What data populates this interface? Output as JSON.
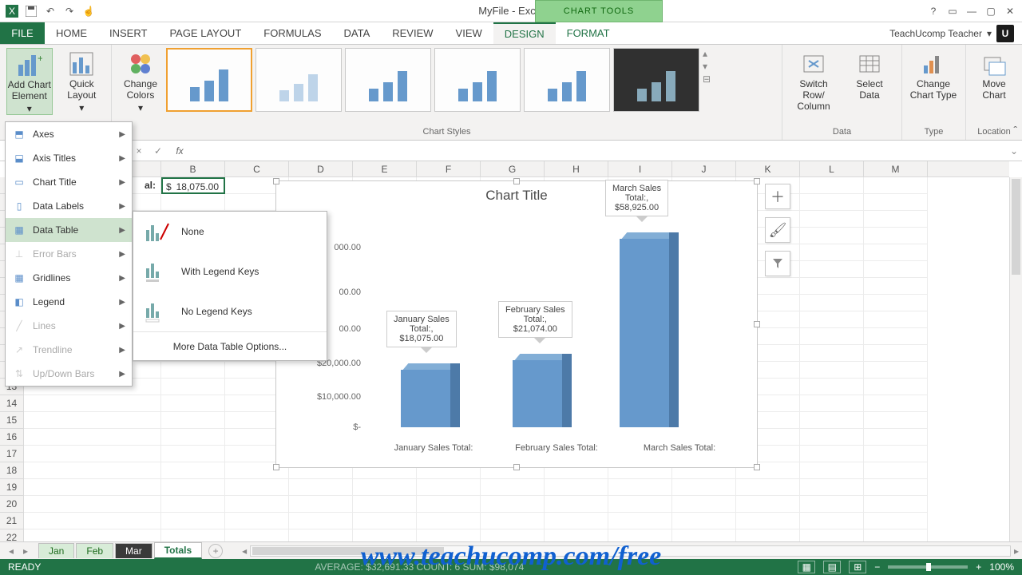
{
  "titlebar": {
    "title": "MyFile - Excel",
    "chart_tools": "CHART TOOLS"
  },
  "tabs": {
    "file": "FILE",
    "home": "HOME",
    "insert": "INSERT",
    "pagelayout": "PAGE LAYOUT",
    "formulas": "FORMULAS",
    "data": "DATA",
    "review": "REVIEW",
    "view": "VIEW",
    "design": "DESIGN",
    "format": "FORMAT",
    "user": "TeachUcomp Teacher"
  },
  "ribbon": {
    "add_chart_element": "Add Chart\nElement",
    "quick_layout": "Quick\nLayout",
    "change_colors": "Change\nColors",
    "switch": "Switch Row/\nColumn",
    "select_data": "Select\nData",
    "change_type": "Change\nChart Type",
    "move_chart": "Move\nChart",
    "group_styles": "Chart Styles",
    "group_data": "Data",
    "group_type": "Type",
    "group_location": "Location"
  },
  "dropdown": {
    "axes": "Axes",
    "axis_titles": "Axis Titles",
    "chart_title": "Chart Title",
    "data_labels": "Data Labels",
    "data_table": "Data Table",
    "error_bars": "Error Bars",
    "gridlines": "Gridlines",
    "legend": "Legend",
    "lines": "Lines",
    "trendline": "Trendline",
    "updown": "Up/Down Bars"
  },
  "submenu": {
    "none": "None",
    "with_legend": "With Legend Keys",
    "no_legend": "No Legend Keys",
    "more": "More Data Table Options..."
  },
  "sheet": {
    "visible_cell_label": "al:",
    "visible_cell_currency": "$",
    "visible_cell_value": "18,075.00",
    "columns": [
      "B",
      "C",
      "D",
      "E",
      "F",
      "G",
      "H",
      "I",
      "J",
      "K",
      "L",
      "M"
    ],
    "tabs": [
      "Jan",
      "Feb",
      "Mar",
      "Totals"
    ]
  },
  "chart_data": {
    "type": "bar",
    "title": "Chart Title",
    "categories": [
      "January Sales Total:",
      "February Sales Total:",
      "March Sales Total:"
    ],
    "values": [
      18075.0,
      21074.0,
      58925.0
    ],
    "labels": [
      "January Sales\nTotal:,\n$18,075.00",
      "February Sales\nTotal:,\n$21,074.00",
      "March Sales\nTotal:,\n$58,925.00"
    ],
    "yticks": [
      "$-",
      "$10,000.00",
      "$20,000.00",
      "00.00",
      "00.00",
      "000.00"
    ],
    "ylim": [
      0,
      60000
    ]
  },
  "statusbar": {
    "ready": "READY",
    "agg": "AVERAGE: $32,691.33    COUNT: 6    SUM: $98,074",
    "zoom": "100%"
  },
  "watermark": "www.teachucomp.com/free"
}
